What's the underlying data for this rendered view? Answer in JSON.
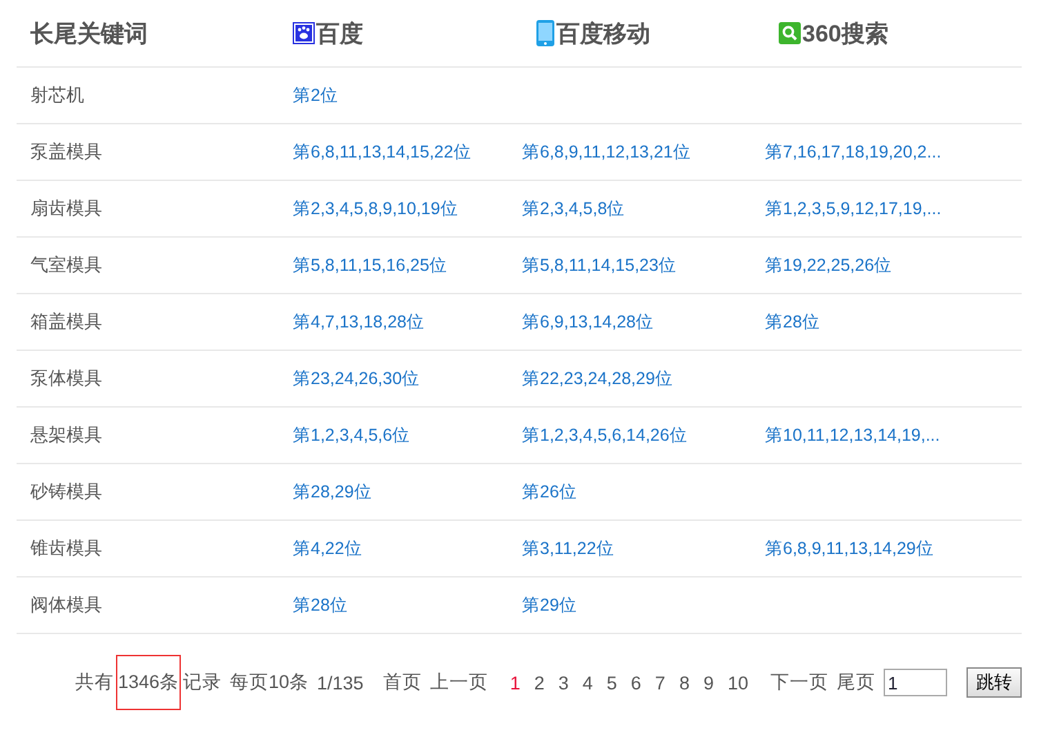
{
  "table": {
    "columns": [
      {
        "label": "长尾关键词",
        "kind": "plain"
      },
      {
        "label": "百度",
        "kind": "paw"
      },
      {
        "label": "百度移动",
        "kind": "phone"
      },
      {
        "label": "360搜索",
        "kind": "search"
      }
    ],
    "rows": [
      {
        "keyword": "射芯机",
        "baidu": "第2位"
      },
      {
        "keyword": "泵盖模具",
        "baidu": "第6,8,11,13,14,15,22位",
        "baidu_mobile": "第6,8,9,11,12,13,21位",
        "search_360": "第7,16,17,18,19,20,2..."
      },
      {
        "keyword": "扇齿模具",
        "baidu": "第2,3,4,5,8,9,10,19位",
        "baidu_mobile": "第2,3,4,5,8位",
        "search_360": "第1,2,3,5,9,12,17,19,..."
      },
      {
        "keyword": "气室模具",
        "baidu": "第5,8,11,15,16,25位",
        "baidu_mobile": "第5,8,11,14,15,23位",
        "search_360": "第19,22,25,26位"
      },
      {
        "keyword": "箱盖模具",
        "baidu": "第4,7,13,18,28位",
        "baidu_mobile": "第6,9,13,14,28位",
        "search_360": "第28位"
      },
      {
        "keyword": "泵体模具",
        "baidu": "第23,24,26,30位",
        "baidu_mobile": "第22,23,24,28,29位"
      },
      {
        "keyword": "悬架模具",
        "baidu": "第1,2,3,4,5,6位",
        "baidu_mobile": "第1,2,3,4,5,6,14,26位",
        "search_360": "第10,11,12,13,14,19,..."
      },
      {
        "keyword": "砂铸模具",
        "baidu": "第28,29位",
        "baidu_mobile": "第26位"
      },
      {
        "keyword": "锥齿模具",
        "baidu": "第4,22位",
        "baidu_mobile": "第3,11,22位",
        "search_360": "第6,8,9,11,13,14,29位"
      },
      {
        "keyword": "阀体模具",
        "baidu": "第28位",
        "baidu_mobile": "第29位"
      }
    ]
  },
  "pagination": {
    "total_prefix": "共有",
    "total_highlighted": "1346条",
    "total_suffix": "记录",
    "per_page": "每页10条",
    "page_info": "1/135",
    "first": "首页",
    "prev": "上一页",
    "pages": [
      {
        "label": "1",
        "selected": true
      },
      {
        "label": "2",
        "selected": false
      },
      {
        "label": "3",
        "selected": false
      },
      {
        "label": "4",
        "selected": false
      },
      {
        "label": "5",
        "selected": false
      },
      {
        "label": "6",
        "selected": false
      },
      {
        "label": "7",
        "selected": false
      },
      {
        "label": "8",
        "selected": false
      },
      {
        "label": "9",
        "selected": false
      },
      {
        "label": "10",
        "selected": false
      }
    ],
    "next": "下一页",
    "last": "尾页",
    "jump_value": "1",
    "jump_button": "跳转"
  }
}
